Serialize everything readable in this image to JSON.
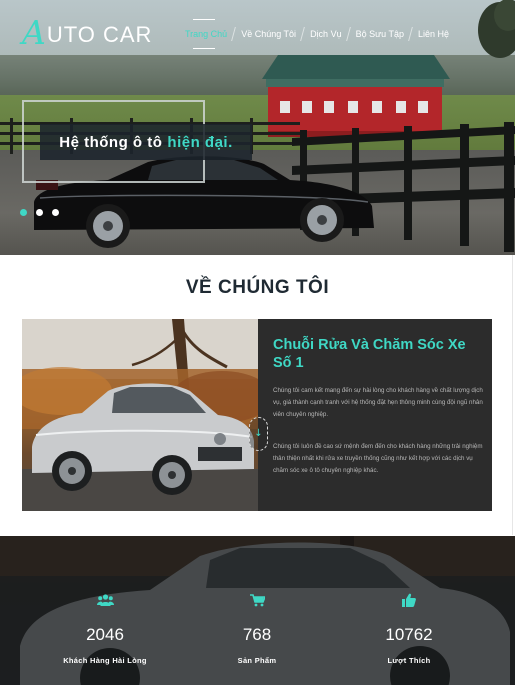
{
  "brand": {
    "logo_letter": "A",
    "logo_text": "UTO CAR"
  },
  "nav": {
    "items": [
      {
        "label": "Trang Chủ",
        "active": true
      },
      {
        "label": "Về Chúng Tôi",
        "active": false
      },
      {
        "label": "Dịch Vụ",
        "active": false
      },
      {
        "label": "Bộ Sưu Tập",
        "active": false
      },
      {
        "label": "Liên Hệ",
        "active": false
      }
    ]
  },
  "hero": {
    "caption_prefix": "Hệ thống ô tô",
    "caption_highlight": "hiện đại.",
    "slides": 3,
    "active_slide": 1
  },
  "about": {
    "title": "VỀ CHÚNG TÔI",
    "heading": "Chuỗi Rửa Và Chăm Sóc Xe Số 1",
    "paragraph_1": "Chúng tôi cam kết mang đến sự hài lòng cho khách hàng về chất lượng dịch vụ, giá thành cạnh tranh với hệ thống đặt hẹn thông minh cùng đội ngũ nhân viên chuyên nghiệp.",
    "paragraph_2": "Chúng tôi luôn đề cao sứ mệnh đem đến cho khách hàng những trải nghiệm thân thiện nhất khi rửa xe truyền thống cũng như kết hợp với các dịch vụ chăm sóc xe ô tô chuyên nghiệp khác.",
    "arrow": "↓"
  },
  "stats": [
    {
      "icon": "users-icon",
      "value": "2046",
      "label": "Khách Hàng Hài Lòng"
    },
    {
      "icon": "cart-icon",
      "value": "768",
      "label": "Sản Phẩm"
    },
    {
      "icon": "thumbs-up-icon",
      "value": "10762",
      "label": "Lượt Thích"
    }
  ],
  "colors": {
    "accent": "#3fd8c5",
    "dark_panel": "#2c2c2c",
    "caption_bg": "#1c242c"
  }
}
